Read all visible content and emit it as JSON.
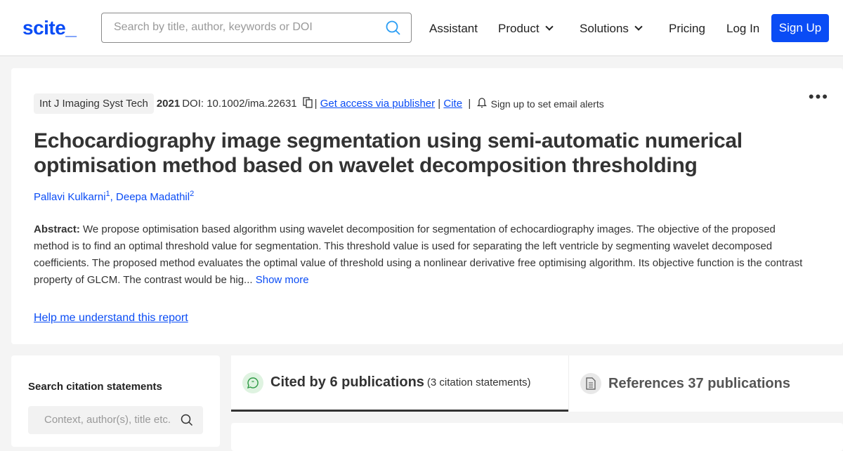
{
  "header": {
    "logo": "scite_",
    "search_placeholder": "Search by title, author, keywords or DOI",
    "nav": {
      "assistant": "Assistant",
      "product": "Product",
      "solutions": "Solutions",
      "pricing": "Pricing",
      "login": "Log In",
      "signup": "Sign Up"
    }
  },
  "paper": {
    "journal": "Int J Imaging Syst Tech",
    "year": "2021",
    "doi": "DOI: 10.1002/ima.22631",
    "access": "Get access via publisher",
    "cite": "Cite",
    "alerts": "Sign up to set email alerts",
    "title": "Echocardiography image segmentation using semi-automatic numerical optimisation method based on wavelet decomposition thresholding",
    "authors": [
      {
        "name": "Pallavi Kulkarni",
        "sup": "1"
      },
      {
        "name": "Deepa Madathil",
        "sup": "2"
      }
    ],
    "abstract_label": "Abstract:",
    "abstract": "We propose optimisation based algorithm using wavelet decomposition for segmentation of echocardiography images. The objective of the proposed method is to find an optimal threshold value for segmentation. This threshold value is used for separating the left ventricle by segmenting wavelet decomposed coefficients. The proposed method evaluates the optimal value of threshold using a nonlinear derivative free optimising algorithm. Its objective function is the contrast property of GLCM. The contrast would be hig...",
    "show_more": "Show more",
    "help": "Help me understand this report"
  },
  "sidebar": {
    "title": "Search citation statements",
    "placeholder": "Context, author(s), title etc."
  },
  "tabs": {
    "cited": "Cited by 6 publications",
    "cited_sub": "(3 citation statements)",
    "refs": "References 37 publications"
  },
  "colors": {
    "brand": "#0a4cf5"
  }
}
